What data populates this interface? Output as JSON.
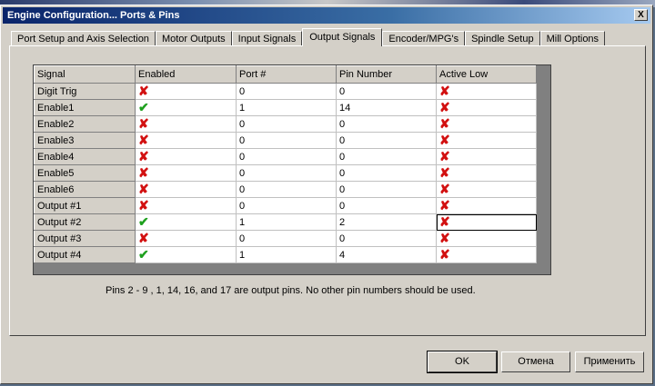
{
  "window": {
    "title": "Engine Configuration... Ports & Pins",
    "close_glyph": "X"
  },
  "tabs": [
    "Port Setup and Axis Selection",
    "Motor Outputs",
    "Input Signals",
    "Output Signals",
    "Encoder/MPG's",
    "Spindle Setup",
    "Mill Options"
  ],
  "active_tab": "Output Signals",
  "table": {
    "columns": [
      "Signal",
      "Enabled",
      "Port #",
      "Pin Number",
      "Active Low"
    ],
    "rows": [
      {
        "signal": "Digit  Trig",
        "enabled": false,
        "port": "0",
        "pin": "0",
        "active_low": false
      },
      {
        "signal": "Enable1",
        "enabled": true,
        "port": "1",
        "pin": "14",
        "active_low": false
      },
      {
        "signal": "Enable2",
        "enabled": false,
        "port": "0",
        "pin": "0",
        "active_low": false
      },
      {
        "signal": "Enable3",
        "enabled": false,
        "port": "0",
        "pin": "0",
        "active_low": false
      },
      {
        "signal": "Enable4",
        "enabled": false,
        "port": "0",
        "pin": "0",
        "active_low": false
      },
      {
        "signal": "Enable5",
        "enabled": false,
        "port": "0",
        "pin": "0",
        "active_low": false
      },
      {
        "signal": "Enable6",
        "enabled": false,
        "port": "0",
        "pin": "0",
        "active_low": false
      },
      {
        "signal": "Output #1",
        "enabled": false,
        "port": "0",
        "pin": "0",
        "active_low": false
      },
      {
        "signal": "Output #2",
        "enabled": true,
        "port": "1",
        "pin": "2",
        "active_low": false
      },
      {
        "signal": "Output #3",
        "enabled": false,
        "port": "0",
        "pin": "0",
        "active_low": false
      },
      {
        "signal": "Output #4",
        "enabled": true,
        "port": "1",
        "pin": "4",
        "active_low": false
      }
    ]
  },
  "note": "Pins 2 - 9 , 1, 14, 16, and 17 are output pins. No  other pin numbers should be used.",
  "buttons": {
    "ok": "OK",
    "cancel": "Отмена",
    "apply": "Применить"
  },
  "icons": {
    "enabled": "green-check-icon",
    "disabled": "red-x-icon"
  },
  "colors": {
    "check": "#1ea01e",
    "cross": "#d21010",
    "title_bar": "#0a246a"
  }
}
